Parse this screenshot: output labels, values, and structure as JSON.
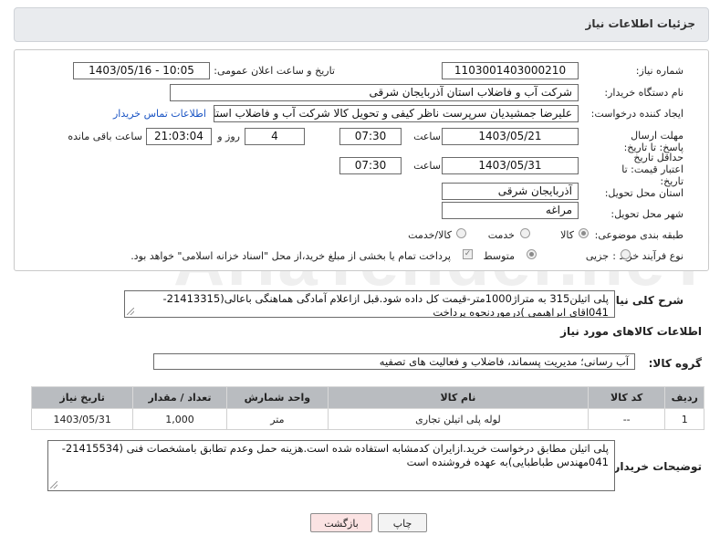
{
  "header": {
    "title": "جزئیات اطلاعات نیاز"
  },
  "form": {
    "need_number": {
      "label": "شماره نیاز:",
      "value": "1103001403000210"
    },
    "announce_datetime": {
      "label": "تاریخ و ساعت اعلان عمومی:",
      "value": "1403/05/16 - 10:05"
    },
    "buyer_org": {
      "label": "نام دستگاه خریدار:",
      "value": "شرکت آب و فاضلاب استان آذربایجان شرقی"
    },
    "requester": {
      "label": "ایجاد کننده درخواست:",
      "value": "علیرضا جمشیدیان سرپرست ناظر کیفی و تحویل کالا شرکت آب و فاضلاب استان",
      "contact_link": "اطلاعات تماس خریدار"
    },
    "response_deadline": {
      "label": "مهلت ارسال پاسخ: تا تاریخ:",
      "date": "1403/05/21",
      "time_label": "ساعت",
      "time": "07:30",
      "days": "4",
      "days_label": "روز و",
      "remaining": "21:03:04",
      "remaining_label": "ساعت باقی مانده"
    },
    "price_validity": {
      "label": "حداقل تاریخ اعتبار قیمت: تا تاریخ:",
      "date": "1403/05/31",
      "time_label": "ساعت",
      "time": "07:30"
    },
    "province": {
      "label": "استان محل تحویل:",
      "value": "آذربایجان شرقی"
    },
    "city": {
      "label": "شهر محل تحویل:",
      "value": "مراغه"
    },
    "category": {
      "label": "طبقه بندی موضوعی:",
      "options": [
        "کالا",
        "خدمت",
        "کالا/خدمت"
      ],
      "selected": "کالا"
    },
    "purchase_type": {
      "label": "نوع فرآیند خرید :",
      "options": [
        "جزیی",
        "متوسط"
      ],
      "selected": "متوسط",
      "note": "پرداخت تمام یا بخشی از مبلغ خرید،از محل \"اسناد خزانه اسلامی\" خواهد بود."
    }
  },
  "description": {
    "label": "شرح کلی نیاز:",
    "text": "پلی اتیلن315 به متراژ1000متر-قیمت کل داده شود.قبل ازاعلام آمادگی هماهنگی باعالی(21413315-041اقای ابراهیمی )درموردنحوه پرداخت"
  },
  "goods_info": {
    "title": "اطلاعات کالاهای مورد نیاز",
    "group_label": "گروه کالا:",
    "group_value": "آب رسانی؛ مدیریت پسماند، فاضلاب و فعالیت های تصفیه"
  },
  "table": {
    "headers": [
      "ردیف",
      "کد کالا",
      "نام کالا",
      "واحد شمارش",
      "تعداد / مقدار",
      "تاریخ نیاز"
    ],
    "rows": [
      [
        "1",
        "--",
        "لوله پلی اتیلن تجاری",
        "متر",
        "1,000",
        "1403/05/31"
      ]
    ]
  },
  "buyer_notes": {
    "label": "توضیحات خریدار:",
    "text": "پلی اتیلن مطابق درخواست خرید.ازایران کدمشابه استفاده شده است.هزینه حمل وعدم تطابق بامشخصات فنی (21415534-041مهندس طباطبایی)به عهده فروشنده است"
  },
  "buttons": {
    "print": "چاپ",
    "back": "بازگشت"
  },
  "watermark": "AriaTender.neT",
  "colors": {
    "header_bg": "#e9ebee",
    "table_header_bg": "#b9bcc0",
    "link": "#1a54c4",
    "back_button_bg": "#fbe3e3"
  }
}
